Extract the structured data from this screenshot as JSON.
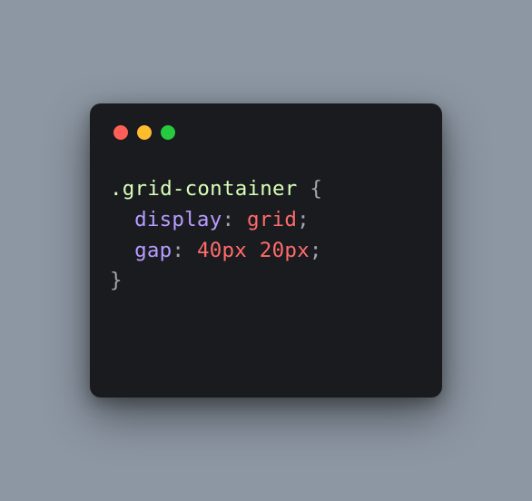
{
  "code": {
    "selector": ".grid-container",
    "brace_open": " {",
    "line1_property": "display",
    "line1_colon": ": ",
    "line1_value": "grid",
    "line1_semi": ";",
    "line2_property": "gap",
    "line2_colon": ": ",
    "line2_value": "40px 20px",
    "line2_semi": ";",
    "brace_close": "}"
  }
}
